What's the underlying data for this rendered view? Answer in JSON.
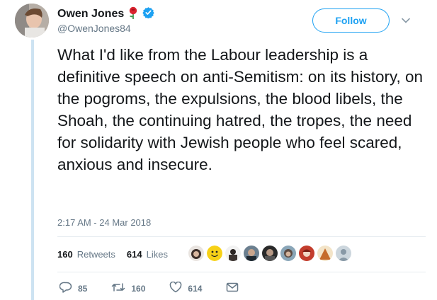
{
  "author": {
    "name": "Owen Jones",
    "handle": "@OwenJones84",
    "name_emoji": "rose",
    "verified": true
  },
  "follow_label": "Follow",
  "tweet_text": "What I'd like from the Labour leadership is a definitive speech on anti-Semitism: on its history, on the pogroms, the expulsions, the blood libels, the Shoah, the continuing hatred, the tropes, the need for solidarity with Jewish people who feel scared, anxious and insecure.",
  "timestamp": "2:17 AM - 24 Mar 2018",
  "stats": {
    "retweets_count": "160",
    "retweets_label": "Retweets",
    "likes_count": "614",
    "likes_label": "Likes"
  },
  "actions": {
    "reply_count": "85",
    "retweet_count": "160",
    "like_count": "614"
  },
  "colors": {
    "accent": "#1da1f2",
    "muted": "#657786",
    "thread_line": "#cde3f2"
  },
  "icons": [
    "rose-emoji-icon",
    "verified-badge-icon",
    "chevron-down-icon",
    "reply-icon",
    "retweet-icon",
    "heart-icon",
    "direct-message-icon"
  ]
}
